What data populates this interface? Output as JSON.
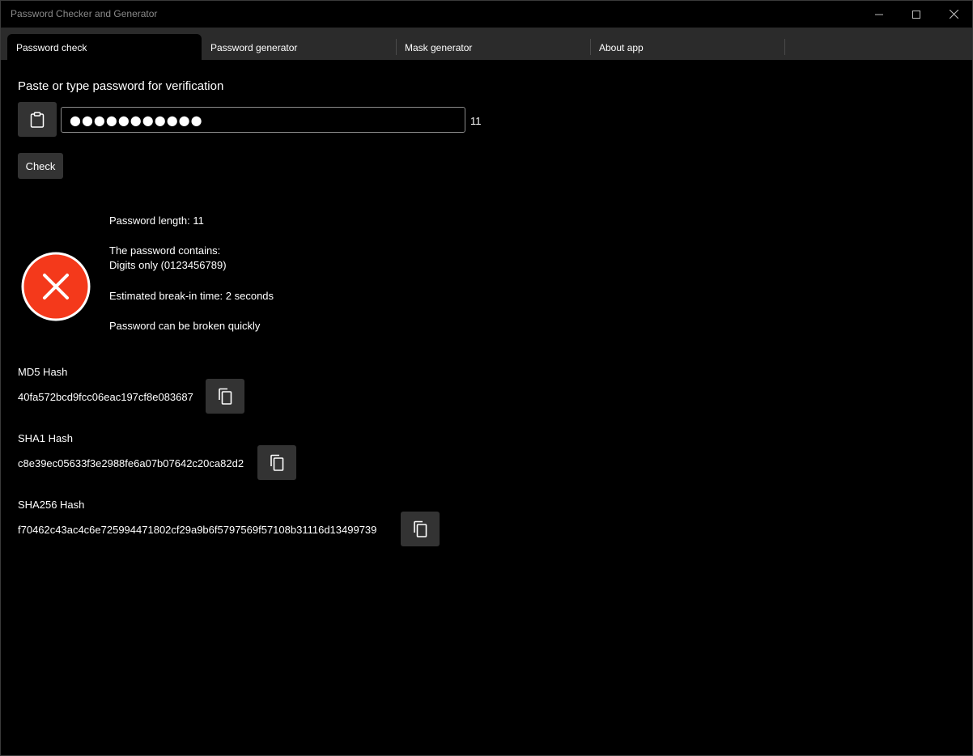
{
  "window": {
    "title": "Password Checker and Generator"
  },
  "tabs": [
    {
      "label": "Password check",
      "active": true
    },
    {
      "label": "Password generator",
      "active": false
    },
    {
      "label": "Mask generator",
      "active": false
    },
    {
      "label": "About app",
      "active": false
    }
  ],
  "check": {
    "prompt": "Paste or type password for verification",
    "password_masked": "●●●●●●●●●●●",
    "char_count": "11",
    "check_label": "Check",
    "paste_icon": "clipboard-icon"
  },
  "result": {
    "status_icon": "error-circle-icon",
    "status_color": "#f4391b",
    "length_line": "Password length: 11",
    "contains_title": "The password contains:",
    "contains_value": "Digits only (0123456789)",
    "break_time": "Estimated break-in time: 2 seconds",
    "verdict": "Password can be broken quickly"
  },
  "hashes": {
    "md5": {
      "label": "MD5 Hash",
      "value": "40fa572bcd9fcc06eac197cf8e083687"
    },
    "sha1": {
      "label": "SHA1 Hash",
      "value": "c8e39ec05633f3e2988fe6a07b07642c20ca82d2"
    },
    "sha256": {
      "label": "SHA256 Hash",
      "value": "f70462c43ac4c6e725994471802cf29a9b6f5797569f57108b31116d13499739"
    }
  },
  "colors": {
    "background": "#000000",
    "tabbar": "#2b2b2b",
    "button": "#333333",
    "error": "#f4391b"
  }
}
